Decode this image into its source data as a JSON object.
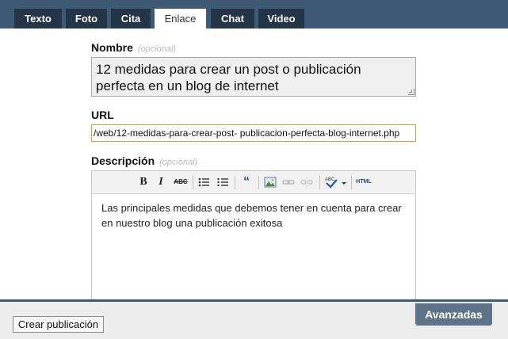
{
  "tabs": [
    "Texto",
    "Foto",
    "Cita",
    "Enlace",
    "Chat",
    "Video"
  ],
  "active_tab": "Enlace",
  "form": {
    "name_label": "Nombre",
    "name_optional": "(opcional)",
    "name_value": "12 medidas para crear un post o publicación perfecta en un blog de internet",
    "url_label": "URL",
    "url_value": "/web/12-medidas-para-crear-post- publicacion-perfecta-blog-internet.php",
    "desc_label": "Descripción",
    "desc_optional": "(opcional)",
    "desc_value": "Las principales medidas que debemos tener en cuenta para crear en nuestro blog una publicación exitosa"
  },
  "toolbar": {
    "bold": "B",
    "italic": "I",
    "strike": "ABC",
    "html": "HTML",
    "icons": [
      "bold-icon",
      "italic-icon",
      "strikethrough-icon",
      "bullet-list-icon",
      "numbered-list-icon",
      "quote-icon",
      "image-icon",
      "link-icon",
      "unlink-icon",
      "spellcheck-icon",
      "html-icon"
    ]
  },
  "footer": {
    "create_label": "Crear publicación",
    "advanced_label": "Avanzadas"
  },
  "colors": {
    "header_bg": "#3f5a74",
    "tab_bg": "#243548",
    "url_focus_border": "#e59a2c",
    "advanced_tab_bg": "#5e7387"
  }
}
